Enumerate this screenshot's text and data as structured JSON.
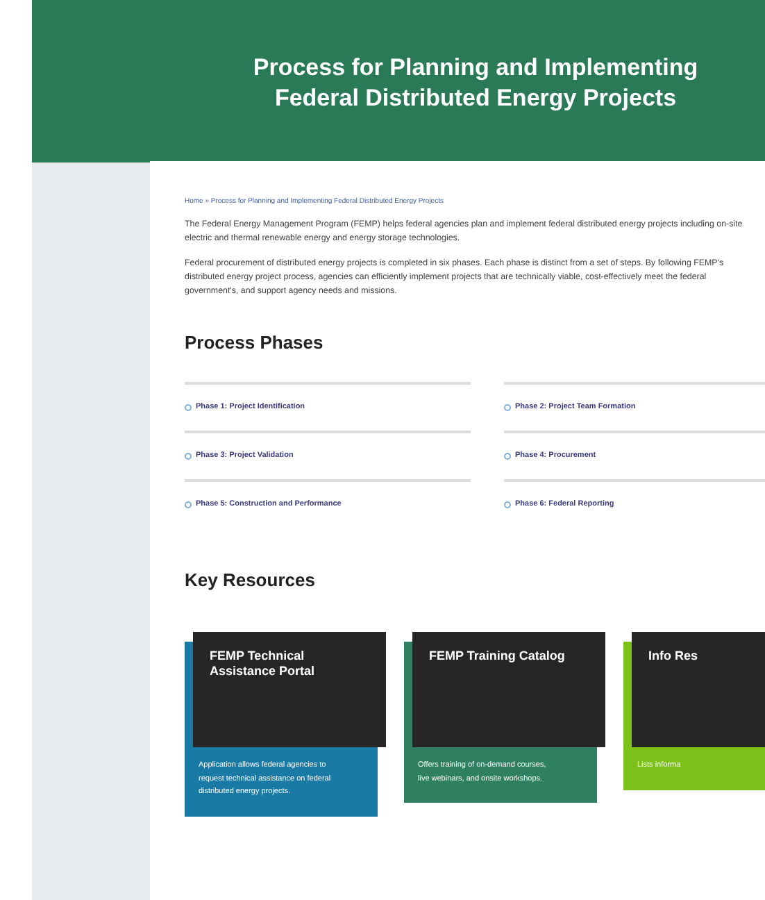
{
  "header": {
    "title": "Process for Planning and Implementing Federal Distributed Energy Projects"
  },
  "breadcrumb": "Home » Process for Planning and Implementing Federal Distributed Energy Projects",
  "intro": [
    "The Federal Energy Management Program (FEMP) helps federal agencies plan and implement federal distributed energy projects including on-site electric and thermal renewable energy and energy storage technologies.",
    "Federal procurement of distributed energy projects is completed in six phases. Each phase is distinct from a set of steps. By following FEMP's distributed energy project process, agencies can efficiently implement projects that are technically viable, cost-effectively meet the federal government's, and support agency needs and missions."
  ],
  "phases": {
    "title": "Process Phases",
    "items": [
      {
        "label": "Phase 1: Project Identification"
      },
      {
        "label": "Phase 2: Project Team Formation"
      },
      {
        "label": "Phase 3: Project Validation"
      },
      {
        "label": "Phase 4: Procurement"
      },
      {
        "label": "Phase 5: Construction and Performance"
      },
      {
        "label": "Phase 6: Federal Reporting"
      }
    ]
  },
  "resources": {
    "title": "Key Resources",
    "cards": [
      {
        "title": "FEMP Technical Assistance Portal",
        "text": "Application allows federal agencies to request technical assistance on federal distributed energy projects.",
        "color": "#1a7aa6"
      },
      {
        "title": "FEMP Training Catalog",
        "text": "Offers training of on-demand courses, live webinars, and onsite workshops.",
        "color": "#2e8060"
      },
      {
        "title": "Info Res",
        "text": "Lists informa",
        "color": "#7cc21a"
      }
    ]
  }
}
